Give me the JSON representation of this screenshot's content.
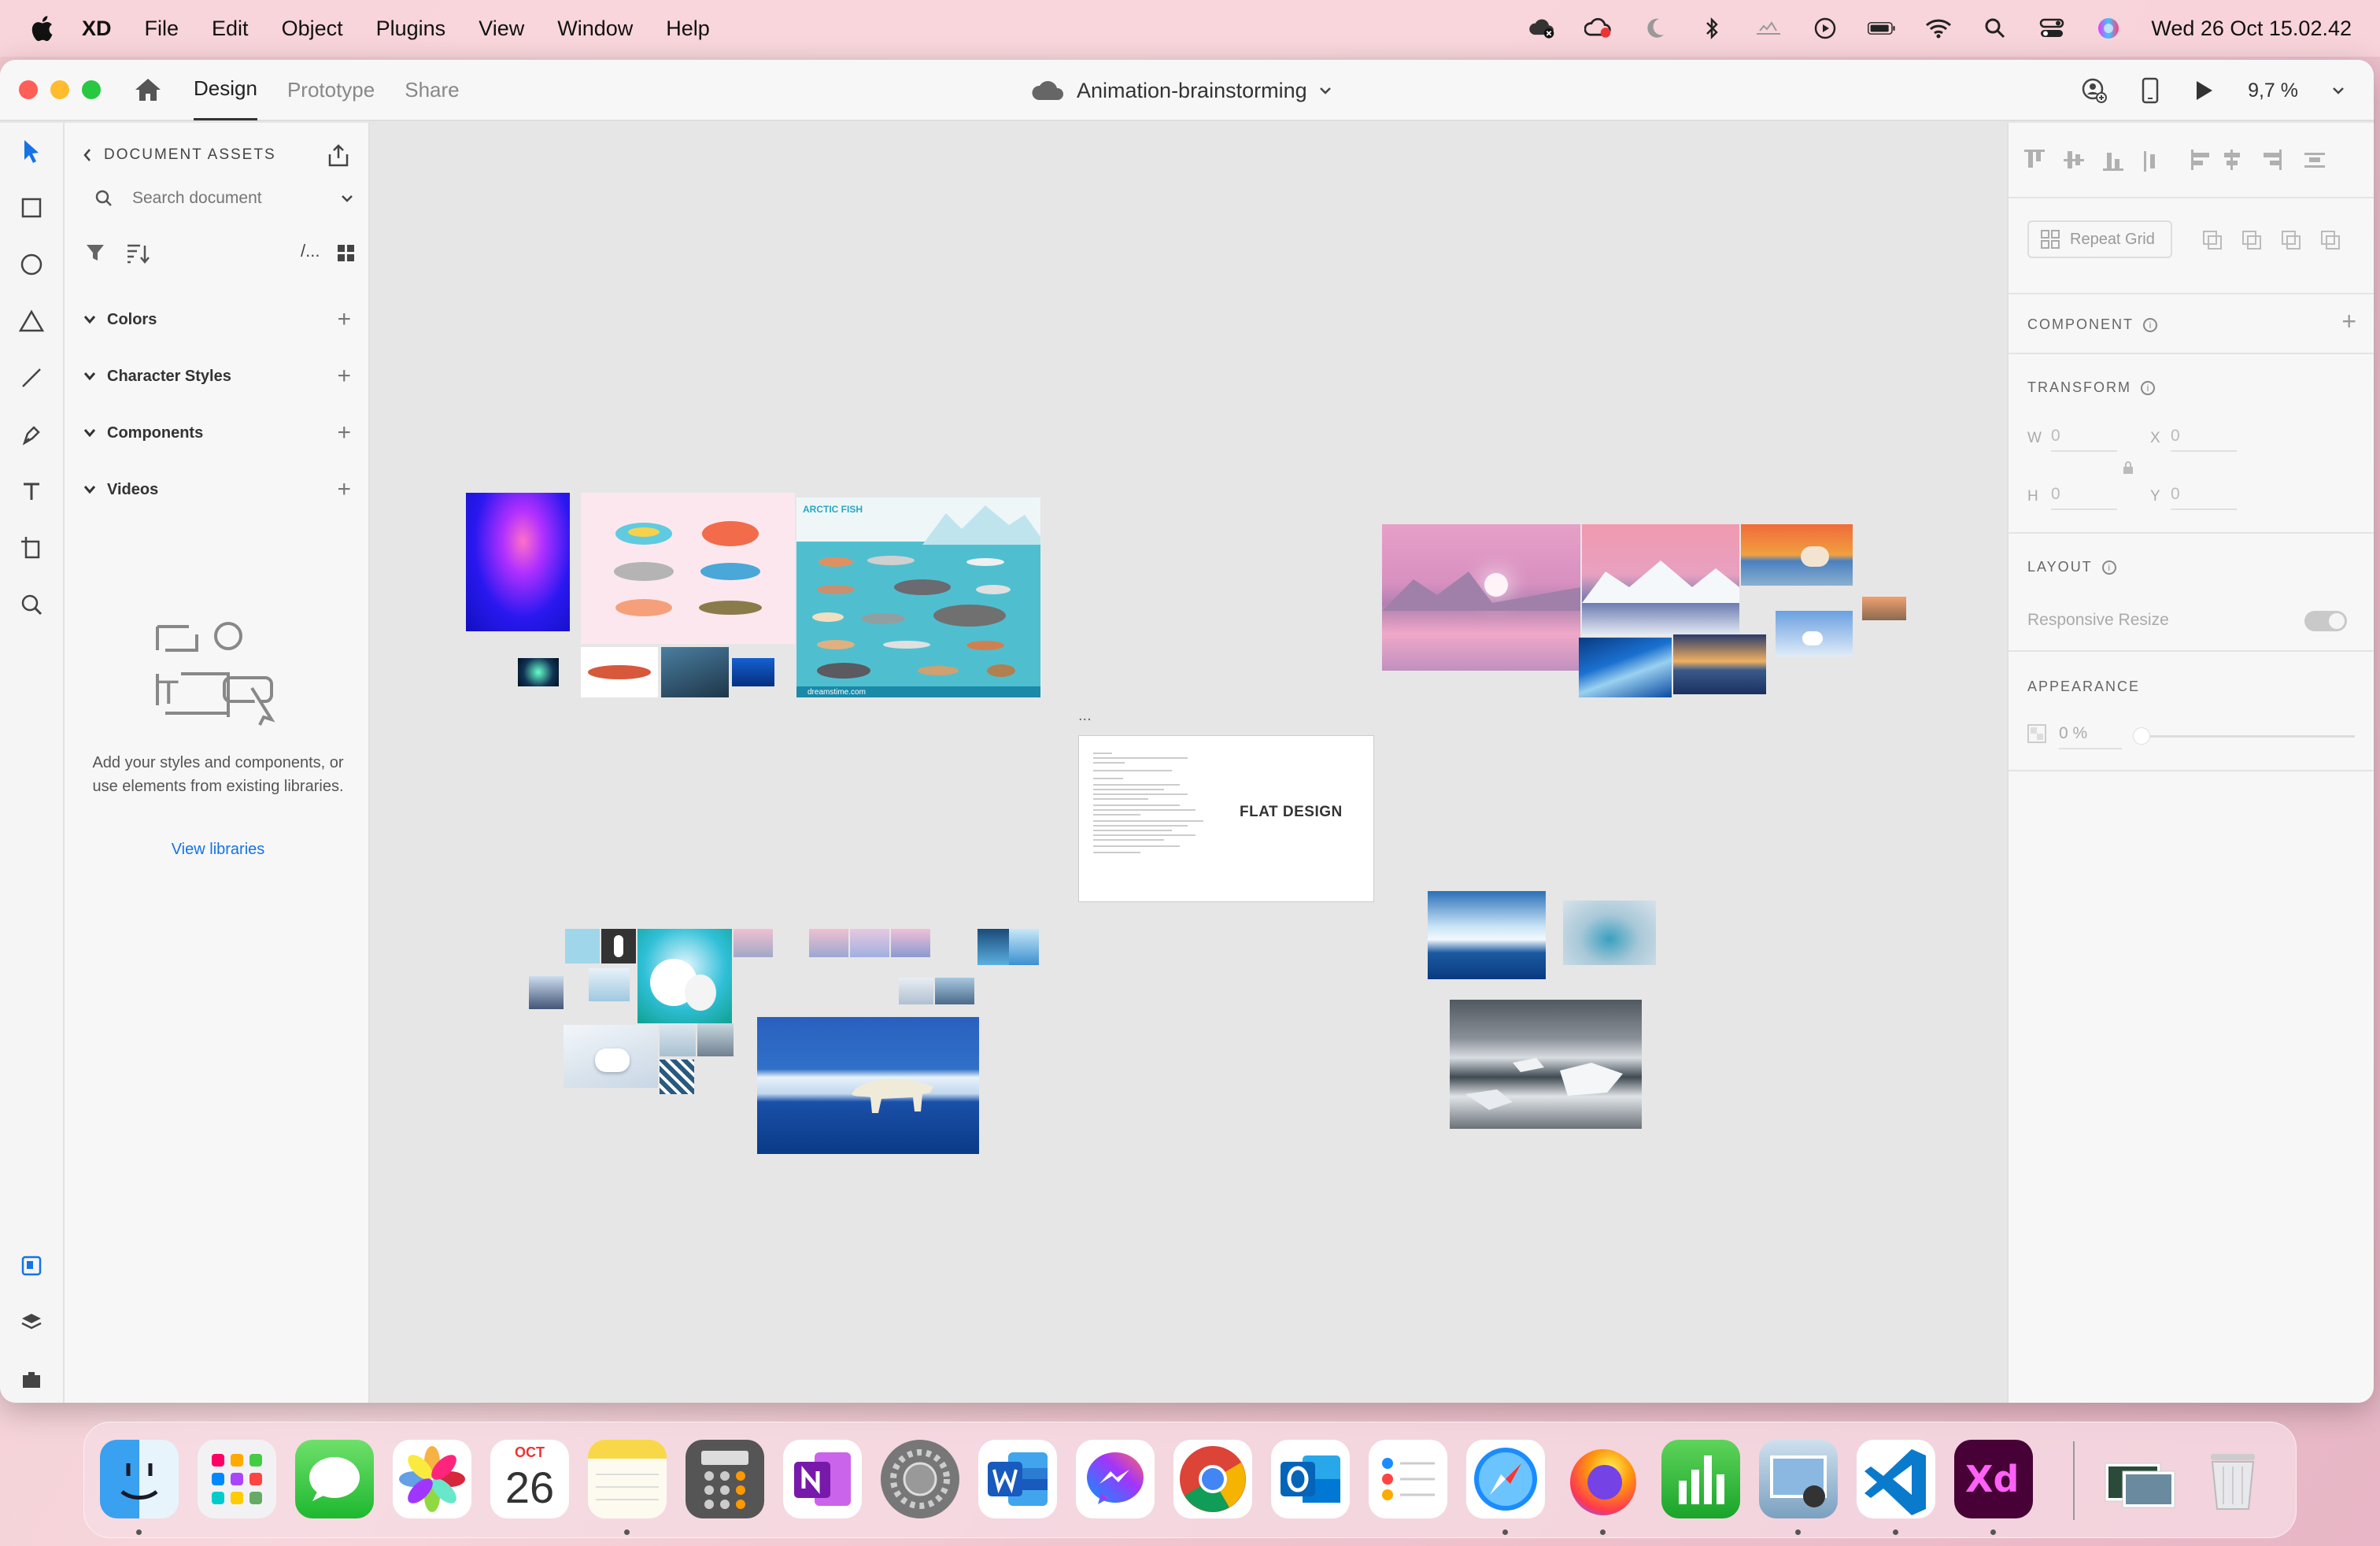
{
  "menubar": {
    "app_name": "XD",
    "items": [
      "File",
      "Edit",
      "Object",
      "Plugins",
      "View",
      "Window",
      "Help"
    ],
    "clock": "Wed 26 Oct  15.02.42"
  },
  "titlebar": {
    "tabs": [
      "Design",
      "Prototype",
      "Share"
    ],
    "active_tab": "Design",
    "document_title": "Animation-brainstorming",
    "zoom": "9,7 %"
  },
  "assets": {
    "header": "DOCUMENT ASSETS",
    "search_placeholder": "Search document",
    "sections": [
      {
        "label": "Colors"
      },
      {
        "label": "Character Styles"
      },
      {
        "label": "Components"
      },
      {
        "label": "Videos"
      }
    ],
    "empty_text": "Add your styles and components, or use elements from existing libraries.",
    "view_libraries": "View libraries",
    "path_icon_text": "/..."
  },
  "canvas": {
    "flat_design_label": "FLAT DESIGN",
    "arctic_fish_title": "ARCTIC FISH",
    "artboard_menu": "...",
    "fish_credit": "dreamstime.com"
  },
  "inspector": {
    "repeat_grid": "Repeat Grid",
    "component_label": "COMPONENT",
    "transform_label": "TRANSFORM",
    "w_label": "W",
    "w_value": "0",
    "h_label": "H",
    "h_value": "0",
    "x_label": "X",
    "x_value": "0",
    "y_label": "Y",
    "y_value": "0",
    "layout_label": "LAYOUT",
    "responsive_resize": "Responsive Resize",
    "appearance_label": "APPEARANCE",
    "opacity": "0 %"
  },
  "dock": {
    "calendar_month": "OCT",
    "calendar_day": "26",
    "apps": [
      "Finder",
      "Launchpad",
      "Messages",
      "Photos",
      "Calendar",
      "Notes",
      "Calculator",
      "OneNote",
      "System Preferences",
      "Word",
      "Messenger",
      "Chrome",
      "Outlook",
      "Reminders",
      "Safari",
      "Firefox",
      "Numbers",
      "Preview",
      "Visual Studio Code",
      "Adobe XD",
      "Downloads",
      "Trash"
    ]
  },
  "colors": {
    "accent": "#1473e6",
    "xd_brand": "#470137",
    "xd_pink": "#ff61f6"
  }
}
